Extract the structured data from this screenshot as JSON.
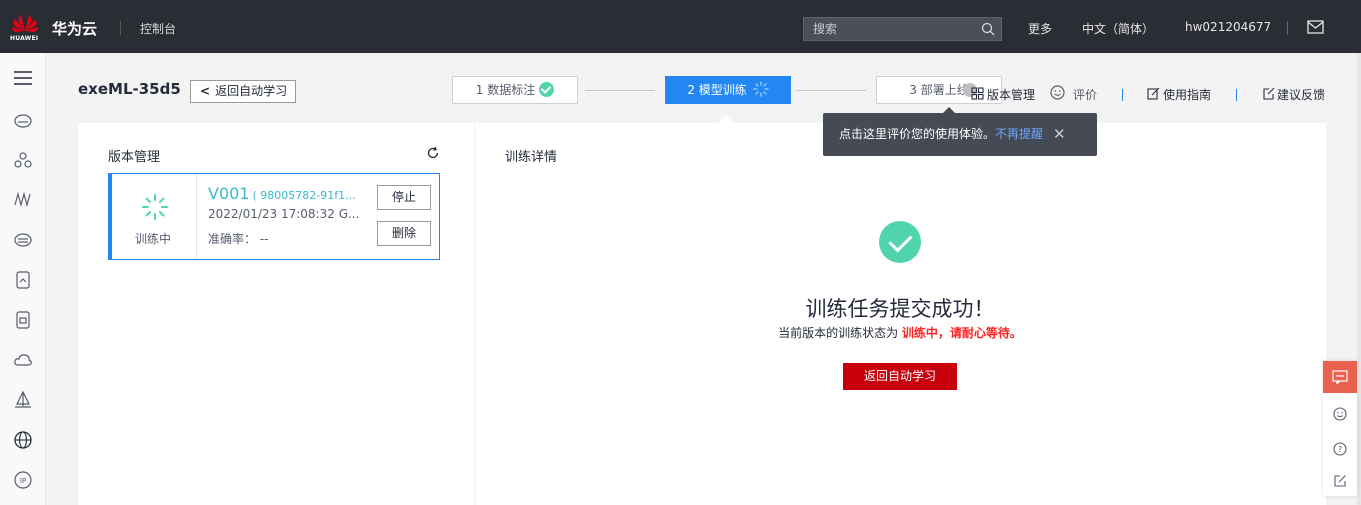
{
  "topbar": {
    "logo_text": "HUAWEI",
    "brand": "华为云",
    "console": "控制台",
    "search_placeholder": "搜索",
    "more": "更多",
    "language": "中文（简体）",
    "username": "hw021204677"
  },
  "leftnav": {
    "icons": [
      "menu-icon",
      "cloud-server-icon",
      "network-icon",
      "monitor-icon",
      "storage-icon",
      "database-icon",
      "container-icon",
      "cloud-icon",
      "deploy-icon",
      "globe-icon",
      "ip-icon"
    ]
  },
  "subheader": {
    "title": "exeML-35d5",
    "back_label": "返回自动学习"
  },
  "steps": [
    {
      "label": "1 数据标注",
      "status": "done"
    },
    {
      "label": "2 模型训练",
      "status": "active"
    },
    {
      "label": "3 部署上线",
      "status": "pending"
    }
  ],
  "tools": {
    "version_mgmt": "版本管理",
    "rate": "评价",
    "guide": "使用指南",
    "feedback": "建议反馈"
  },
  "tooltip": {
    "text": "点击这里评价您的使用体验。",
    "link": "不再提醒",
    "close": "✕"
  },
  "left_panel": {
    "title": "版本管理",
    "card": {
      "status_text": "训练中",
      "version": "V001",
      "hash": "( 98005782-91f1...",
      "time": "2022/01/23 17:08:32 G...",
      "accuracy_label": "准确率：",
      "accuracy_value": "--",
      "stop_label": "停止",
      "delete_label": "删除"
    }
  },
  "right_panel": {
    "title": "训练详情",
    "success_title": "训练任务提交成功！",
    "status_prefix": "当前版本的训练状态为 ",
    "status_highlight": "训练中，请耐心等待。",
    "back_button": "返回自动学习"
  },
  "colors": {
    "topbar": "#2a2d34",
    "accent_blue": "#2387f3",
    "success_green": "#50d4ab",
    "primary_red": "#c7000b",
    "highlight_red": "#ff2222",
    "version_teal": "#39b9c9",
    "float_orange": "#e8624f"
  }
}
